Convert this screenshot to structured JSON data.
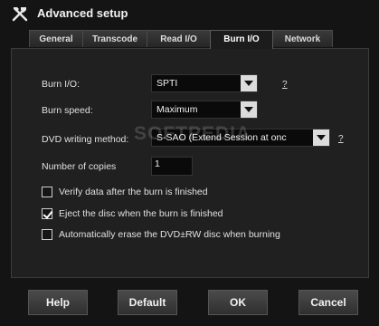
{
  "window": {
    "title": "Advanced setup"
  },
  "tabs": [
    {
      "label": "General"
    },
    {
      "label": "Transcode"
    },
    {
      "label": "Read I/O"
    },
    {
      "label": "Burn I/O"
    },
    {
      "label": "Network"
    }
  ],
  "active_tab": "Burn I/O",
  "form": {
    "burn_io": {
      "label": "Burn I/O:",
      "value": "SPTI",
      "help": "?"
    },
    "burn_speed": {
      "label": "Burn speed:",
      "value": "Maximum"
    },
    "dvd_writing_method": {
      "label": "DVD writing method:",
      "value": "S-SAO (Extend Session at onc",
      "help": "?"
    },
    "copies": {
      "label": "Number of copies",
      "value": "1"
    }
  },
  "options": [
    {
      "label": "Verify data after the burn is finished",
      "checked": false
    },
    {
      "label": "Eject the disc when the burn is finished",
      "checked": true
    },
    {
      "label": "Automatically erase the DVD±RW disc when burning",
      "checked": false
    }
  ],
  "buttons": {
    "help": "Help",
    "default": "Default",
    "ok": "OK",
    "cancel": "Cancel"
  },
  "watermark": "SOFTPEDIA",
  "colors": {
    "background": "#141414",
    "panel": "#202020",
    "combo_button": "#dcdcdc"
  },
  "icons": {
    "app": "tools-icon",
    "dropdown": "triangle-down-icon"
  }
}
